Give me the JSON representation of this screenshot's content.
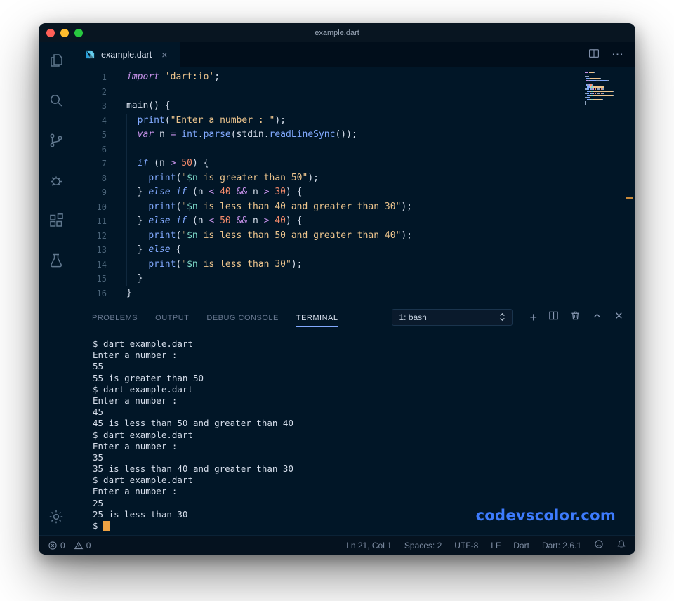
{
  "window": {
    "title": "example.dart"
  },
  "tabbar": {
    "tab_label": "example.dart"
  },
  "icons": {
    "close_glyph": "×",
    "more_glyph": "⋯",
    "plus_glyph": "+"
  },
  "editor": {
    "lines": [
      {
        "n": "1",
        "g": [],
        "s": [
          [
            "k",
            "import"
          ],
          [
            "p",
            " "
          ],
          [
            "s",
            "'dart:io'"
          ],
          [
            "p",
            ";"
          ]
        ]
      },
      {
        "n": "2",
        "g": [],
        "s": []
      },
      {
        "n": "3",
        "g": [],
        "s": [
          [
            "p",
            "main() {"
          ]
        ]
      },
      {
        "n": "4",
        "g": [
          0
        ],
        "s": [
          [
            "p",
            "  "
          ],
          [
            "f",
            "print"
          ],
          [
            "p",
            "("
          ],
          [
            "s",
            "\"Enter a number : \""
          ],
          [
            "p",
            ");"
          ]
        ]
      },
      {
        "n": "5",
        "g": [
          0
        ],
        "s": [
          [
            "p",
            "  "
          ],
          [
            "k",
            "var"
          ],
          [
            "p",
            " n "
          ],
          [
            "o",
            "="
          ],
          [
            "p",
            " "
          ],
          [
            "f",
            "int"
          ],
          [
            "p",
            "."
          ],
          [
            "f",
            "parse"
          ],
          [
            "p",
            "(stdin."
          ],
          [
            "f",
            "readLineSync"
          ],
          [
            "p",
            "());"
          ]
        ]
      },
      {
        "n": "6",
        "g": [
          0
        ],
        "s": []
      },
      {
        "n": "7",
        "g": [
          0
        ],
        "s": [
          [
            "p",
            "  "
          ],
          [
            "c",
            "if"
          ],
          [
            "p",
            " (n "
          ],
          [
            "o",
            ">"
          ],
          [
            "p",
            " "
          ],
          [
            "num",
            "50"
          ],
          [
            "p",
            ") {"
          ]
        ]
      },
      {
        "n": "8",
        "g": [
          0,
          1
        ],
        "s": [
          [
            "p",
            "    "
          ],
          [
            "f",
            "print"
          ],
          [
            "p",
            "("
          ],
          [
            "s",
            "\""
          ],
          [
            "i",
            "$n"
          ],
          [
            "s",
            " is greater than 50\""
          ],
          [
            "p",
            ");"
          ]
        ]
      },
      {
        "n": "9",
        "g": [
          0
        ],
        "s": [
          [
            "p",
            "  } "
          ],
          [
            "c",
            "else"
          ],
          [
            "p",
            " "
          ],
          [
            "c",
            "if"
          ],
          [
            "p",
            " (n "
          ],
          [
            "o",
            "<"
          ],
          [
            "p",
            " "
          ],
          [
            "num",
            "40"
          ],
          [
            "p",
            " "
          ],
          [
            "o",
            "&&"
          ],
          [
            "p",
            " n "
          ],
          [
            "o",
            ">"
          ],
          [
            "p",
            " "
          ],
          [
            "num",
            "30"
          ],
          [
            "p",
            ") {"
          ]
        ]
      },
      {
        "n": "10",
        "g": [
          0,
          1
        ],
        "s": [
          [
            "p",
            "    "
          ],
          [
            "f",
            "print"
          ],
          [
            "p",
            "("
          ],
          [
            "s",
            "\""
          ],
          [
            "i",
            "$n"
          ],
          [
            "s",
            " is less than 40 and greater than 30\""
          ],
          [
            "p",
            ");"
          ]
        ]
      },
      {
        "n": "11",
        "g": [
          0
        ],
        "s": [
          [
            "p",
            "  } "
          ],
          [
            "c",
            "else"
          ],
          [
            "p",
            " "
          ],
          [
            "c",
            "if"
          ],
          [
            "p",
            " (n "
          ],
          [
            "o",
            "<"
          ],
          [
            "p",
            " "
          ],
          [
            "num",
            "50"
          ],
          [
            "p",
            " "
          ],
          [
            "o",
            "&&"
          ],
          [
            "p",
            " n "
          ],
          [
            "o",
            ">"
          ],
          [
            "p",
            " "
          ],
          [
            "num",
            "40"
          ],
          [
            "p",
            ") {"
          ]
        ]
      },
      {
        "n": "12",
        "g": [
          0,
          1
        ],
        "s": [
          [
            "p",
            "    "
          ],
          [
            "f",
            "print"
          ],
          [
            "p",
            "("
          ],
          [
            "s",
            "\""
          ],
          [
            "i",
            "$n"
          ],
          [
            "s",
            " is less than 50 and greater than 40\""
          ],
          [
            "p",
            ");"
          ]
        ]
      },
      {
        "n": "13",
        "g": [
          0
        ],
        "s": [
          [
            "p",
            "  } "
          ],
          [
            "c",
            "else"
          ],
          [
            "p",
            " {"
          ]
        ]
      },
      {
        "n": "14",
        "g": [
          0,
          1
        ],
        "s": [
          [
            "p",
            "    "
          ],
          [
            "f",
            "print"
          ],
          [
            "p",
            "("
          ],
          [
            "s",
            "\""
          ],
          [
            "i",
            "$n"
          ],
          [
            "s",
            " is less than 30\""
          ],
          [
            "p",
            ");"
          ]
        ]
      },
      {
        "n": "15",
        "g": [
          0
        ],
        "s": [
          [
            "p",
            "  }"
          ]
        ]
      },
      {
        "n": "16",
        "g": [],
        "s": [
          [
            "p",
            "}"
          ]
        ]
      }
    ]
  },
  "panel": {
    "tabs": [
      {
        "label": "PROBLEMS",
        "active": false
      },
      {
        "label": "OUTPUT",
        "active": false
      },
      {
        "label": "DEBUG CONSOLE",
        "active": false
      },
      {
        "label": "TERMINAL",
        "active": true
      }
    ],
    "dropdown_value": "1: bash"
  },
  "terminal": {
    "lines": [
      "$ dart example.dart",
      "Enter a number : ",
      "55",
      "55 is greater than 50",
      "$ dart example.dart",
      "Enter a number : ",
      "45",
      "45 is less than 50 and greater than 40",
      "$ dart example.dart",
      "Enter a number : ",
      "35",
      "35 is less than 40 and greater than 30",
      "$ dart example.dart",
      "Enter a number : ",
      "25",
      "25 is less than 30",
      "$ "
    ],
    "watermark": "codevscolor.com"
  },
  "status": {
    "errors": "0",
    "warnings": "0",
    "right_items": [
      "Ln 21, Col 1",
      "Spaces: 2",
      "UTF-8",
      "LF",
      "Dart",
      "Dart: 2.6.1"
    ]
  },
  "colors": {
    "editor_bg": "#011627",
    "keyword": "#c792ea",
    "control": "#82aaff",
    "string": "#ecc48d",
    "number": "#f78c6c",
    "function": "#82aaff",
    "interpolation": "#7fdbca",
    "terminal_cursor": "#eea243",
    "watermark": "#3d7bfd",
    "panel_tab_underline": "#82aaff",
    "traffic_red": "#ff5f57",
    "traffic_yellow": "#febc2e",
    "traffic_green": "#28c840"
  }
}
